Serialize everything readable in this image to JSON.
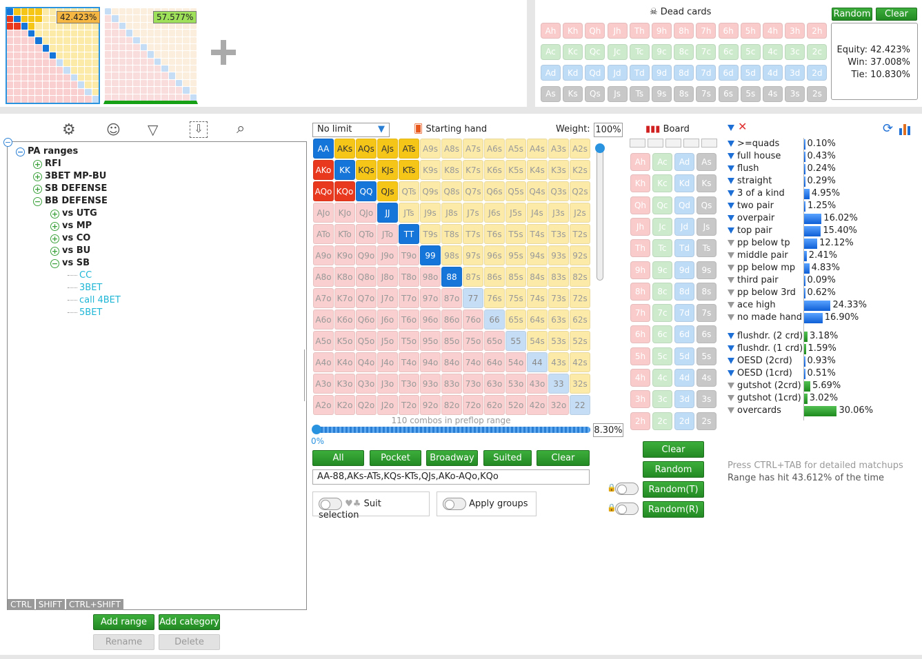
{
  "ranges": {
    "left_pct": "42.423%",
    "right_pct": "57.577%"
  },
  "dead": {
    "title": "Dead cards",
    "random": "Random",
    "clear": "Clear",
    "equity": "Equity: 42.423%",
    "win": "Win: 37.008%",
    "tie": "Tie: 10.830%",
    "ranks": [
      "A",
      "K",
      "Q",
      "J",
      "T",
      "9",
      "8",
      "7",
      "6",
      "5",
      "4",
      "3",
      "2"
    ],
    "suits": [
      "h",
      "c",
      "d",
      "s"
    ]
  },
  "tree": {
    "root": "PA ranges",
    "items": [
      {
        "label": "RFI",
        "level": 1,
        "sign": "+"
      },
      {
        "label": "3BET MP-BU",
        "level": 1,
        "sign": "+"
      },
      {
        "label": "SB DEFENSE",
        "level": 1,
        "sign": "+"
      },
      {
        "label": "BB DEFENSE",
        "level": 1,
        "sign": "−"
      },
      {
        "label": "vs UTG",
        "level": 2,
        "sign": "+"
      },
      {
        "label": "vs MP",
        "level": 2,
        "sign": "+"
      },
      {
        "label": "vs CO",
        "level": 2,
        "sign": "+"
      },
      {
        "label": "vs BU",
        "level": 2,
        "sign": "+"
      },
      {
        "label": "vs SB",
        "level": 2,
        "sign": "−"
      },
      {
        "label": "CC",
        "level": 3,
        "sign": ""
      },
      {
        "label": "3BET",
        "level": 3,
        "sign": ""
      },
      {
        "label": "call 4BET",
        "level": 3,
        "sign": ""
      },
      {
        "label": "5BET",
        "level": 3,
        "sign": ""
      }
    ],
    "mods": [
      "CTRL",
      "SHIFT",
      "CTRL+SHIFT"
    ],
    "add_range": "Add range",
    "add_category": "Add category",
    "rename": "Rename",
    "delete": "Delete"
  },
  "grid": {
    "game": "No limit",
    "starting_hand": "Starting hand",
    "weight_label": "Weight:",
    "weight_value": "100%",
    "combos": "110 combos in preflop range",
    "slider_min": "0%",
    "slider_value": "8.30%",
    "buttons": [
      "All",
      "Pocket",
      "Broadway",
      "Suited",
      "Clear"
    ],
    "range_text": "AA-88,AKs-ATs,KQs-KTs,QJs,AKo-AQo,KQo",
    "suit_selection": "Suit selection",
    "apply_groups": "Apply groups"
  },
  "board": {
    "title": "Board",
    "clear": "Clear",
    "random": "Random",
    "random_t": "Random(T)",
    "random_r": "Random(R)"
  },
  "stats": {
    "made": [
      {
        "label": ">=quads",
        "value": "0.10%",
        "w": 0.1,
        "f": true
      },
      {
        "label": "full house",
        "value": "0.43%",
        "w": 0.43,
        "f": true
      },
      {
        "label": "flush",
        "value": "0.24%",
        "w": 0.24,
        "f": true
      },
      {
        "label": "straight",
        "value": "0.29%",
        "w": 0.29,
        "f": true
      },
      {
        "label": "3 of a kind",
        "value": "4.95%",
        "w": 4.95,
        "f": true
      },
      {
        "label": "two pair",
        "value": "1.25%",
        "w": 1.25,
        "f": true
      },
      {
        "label": "overpair",
        "value": "16.02%",
        "w": 16.02,
        "f": true
      },
      {
        "label": "top pair",
        "value": "15.40%",
        "w": 15.4,
        "f": true
      },
      {
        "label": "pp below tp",
        "value": "12.12%",
        "w": 12.12,
        "f": false
      },
      {
        "label": "middle pair",
        "value": "2.41%",
        "w": 2.41,
        "f": false
      },
      {
        "label": "pp below mp",
        "value": "4.83%",
        "w": 4.83,
        "f": false
      },
      {
        "label": "third pair",
        "value": "0.09%",
        "w": 0.09,
        "f": false
      },
      {
        "label": "pp below 3rd",
        "value": "0.62%",
        "w": 0.62,
        "f": false
      },
      {
        "label": "ace high",
        "value": "24.33%",
        "w": 24.33,
        "f": false
      },
      {
        "label": "no made hand",
        "value": "16.90%",
        "w": 16.9,
        "f": false
      }
    ],
    "draws": [
      {
        "label": "flushdr. (2 crd)",
        "value": "3.18%",
        "w": 3.18,
        "f": true
      },
      {
        "label": "flushdr. (1 crd)",
        "value": "1.59%",
        "w": 1.59,
        "f": true
      },
      {
        "label": "OESD (2crd)",
        "value": "0.93%",
        "w": 0.93,
        "f": true
      },
      {
        "label": "OESD (1crd)",
        "value": "0.51%",
        "w": 0.51,
        "f": true
      },
      {
        "label": "gutshot (2crd)",
        "value": "5.69%",
        "w": 5.69,
        "f": false
      },
      {
        "label": "gutshot (1crd)",
        "value": "3.02%",
        "w": 3.02,
        "f": false
      },
      {
        "label": "overcards",
        "value": "30.06%",
        "w": 30.06,
        "f": false
      }
    ],
    "hint": "Press CTRL+TAB for detailed matchups",
    "hit": "Range has hit 43.612% of the time"
  }
}
